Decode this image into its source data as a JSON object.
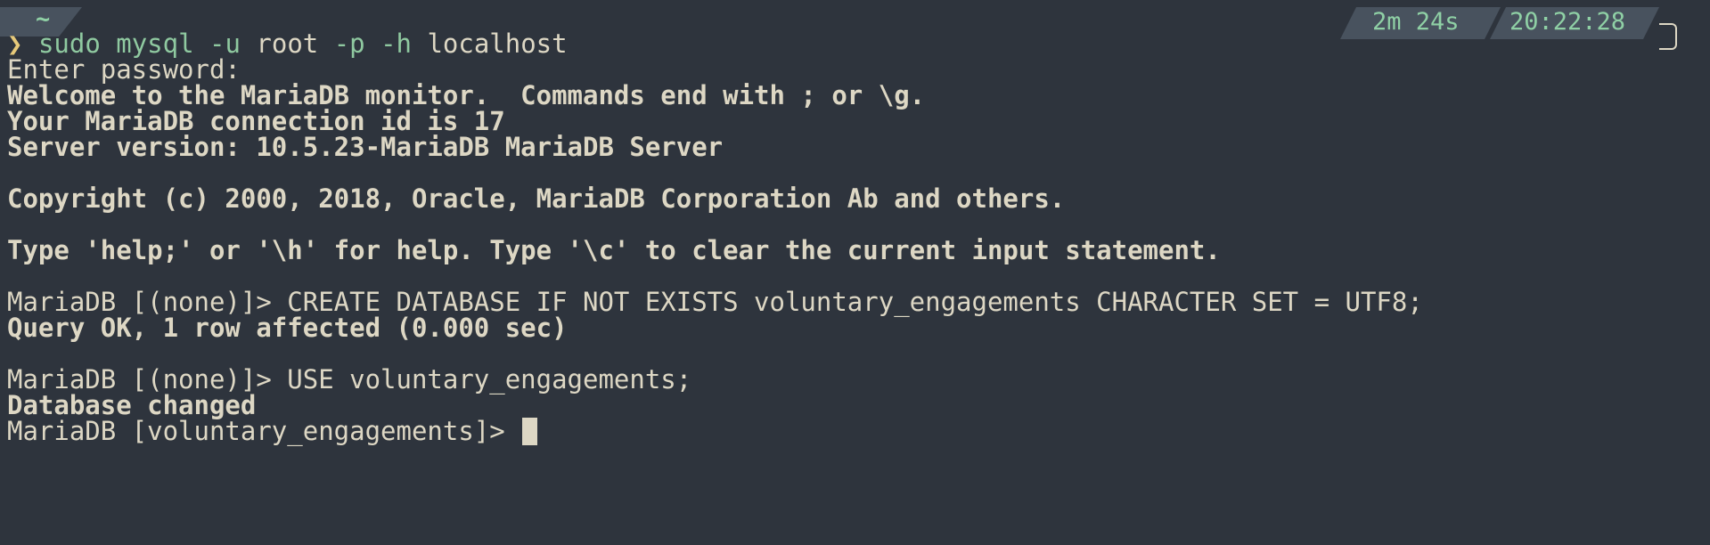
{
  "prompt": {
    "directory": "~",
    "duration": "2m 24s",
    "separator": "/",
    "time": "20:22:28",
    "arrow": "❯",
    "command_name": "sudo",
    "command_sep": " ",
    "command_bin": "mysql",
    "command_args_1": " -u ",
    "command_arg_user": "root",
    "command_args_2": " -p -h ",
    "command_arg_host": "localhost"
  },
  "output": {
    "enter_password": "Enter password:",
    "welcome": "Welcome to the MariaDB monitor.  Commands end with ; or \\g.",
    "connection_id": "Your MariaDB connection id is 17",
    "server_version": "Server version: 10.5.23-MariaDB MariaDB Server",
    "copyright": "Copyright (c) 2000, 2018, Oracle, MariaDB Corporation Ab and others.",
    "help": "Type 'help;' or '\\h' for help. Type '\\c' to clear the current input statement.",
    "create_cmd": "MariaDB [(none)]> CREATE DATABASE IF NOT EXISTS voluntary_engagements CHARACTER SET = UTF8;",
    "query_ok": "Query OK, 1 row affected (0.000 sec)",
    "use_cmd": "MariaDB [(none)]> USE voluntary_engagements;",
    "db_changed": "Database changed",
    "current_prompt": "MariaDB [voluntary_engagements]> "
  },
  "colors": {
    "background": "#2e343d",
    "foreground": "#ddd7c4",
    "accent_green": "#8fd0a5",
    "segment_bg": "#48525e",
    "arrow_yellow": "#e6c97a"
  }
}
